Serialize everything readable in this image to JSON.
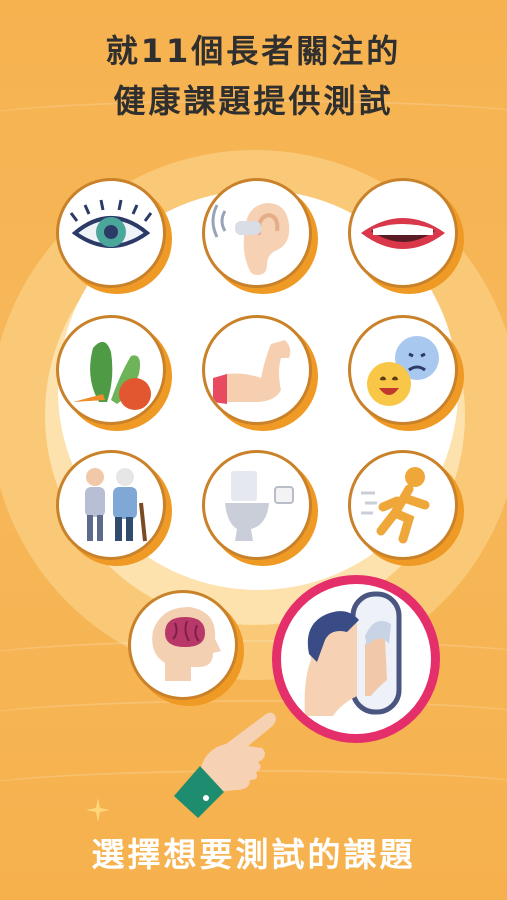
{
  "title": {
    "line1": "就11個長者關注的",
    "line2": "健康課題提供測試"
  },
  "bottom_caption": "選擇想要測試的課題",
  "topics": [
    {
      "icon": "eye-icon"
    },
    {
      "icon": "ear-hearing-icon"
    },
    {
      "icon": "mouth-teeth-icon"
    },
    {
      "icon": "vegetables-nutrition-icon"
    },
    {
      "icon": "muscle-arm-icon"
    },
    {
      "icon": "mood-faces-icon"
    },
    {
      "icon": "elderly-walking-cane-icon"
    },
    {
      "icon": "toilet-icon"
    },
    {
      "icon": "running-person-icon"
    },
    {
      "icon": "brain-head-icon"
    },
    {
      "icon": "mirror-self-image-icon",
      "selected": true
    }
  ],
  "colors": {
    "background": "#f6b24f",
    "selected_ring": "#e52f6b",
    "title_text": "#2f2f2f",
    "caption_text": "#ffffff"
  }
}
